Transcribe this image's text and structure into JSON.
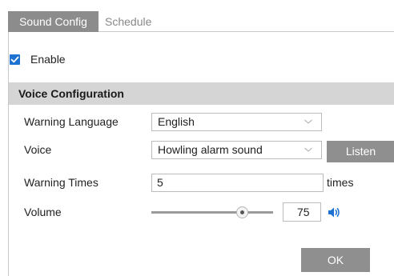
{
  "tabs": [
    {
      "label": "Sound Config",
      "active": true
    },
    {
      "label": "Schedule",
      "active": false
    }
  ],
  "enable": {
    "label": "Enable",
    "checked": true
  },
  "section": {
    "title": "Voice Configuration"
  },
  "fields": {
    "warning_language": {
      "label": "Warning Language",
      "value": "English"
    },
    "voice": {
      "label": "Voice",
      "value": "Howling alarm sound",
      "listen_label": "Listen"
    },
    "warning_times": {
      "label": "Warning Times",
      "value": "5",
      "unit": "times"
    },
    "volume": {
      "label": "Volume",
      "value": "75",
      "level": 75
    }
  },
  "ok_label": "OK",
  "colors": {
    "accent": "#1e73d2",
    "button": "#8f8f8f",
    "tab_active": "#8c8c8c",
    "section_header": "#d5d5d5"
  },
  "icons": {
    "checkbox": "check-icon",
    "dropdown": "chevron-down-icon",
    "volume": "speaker-icon"
  }
}
